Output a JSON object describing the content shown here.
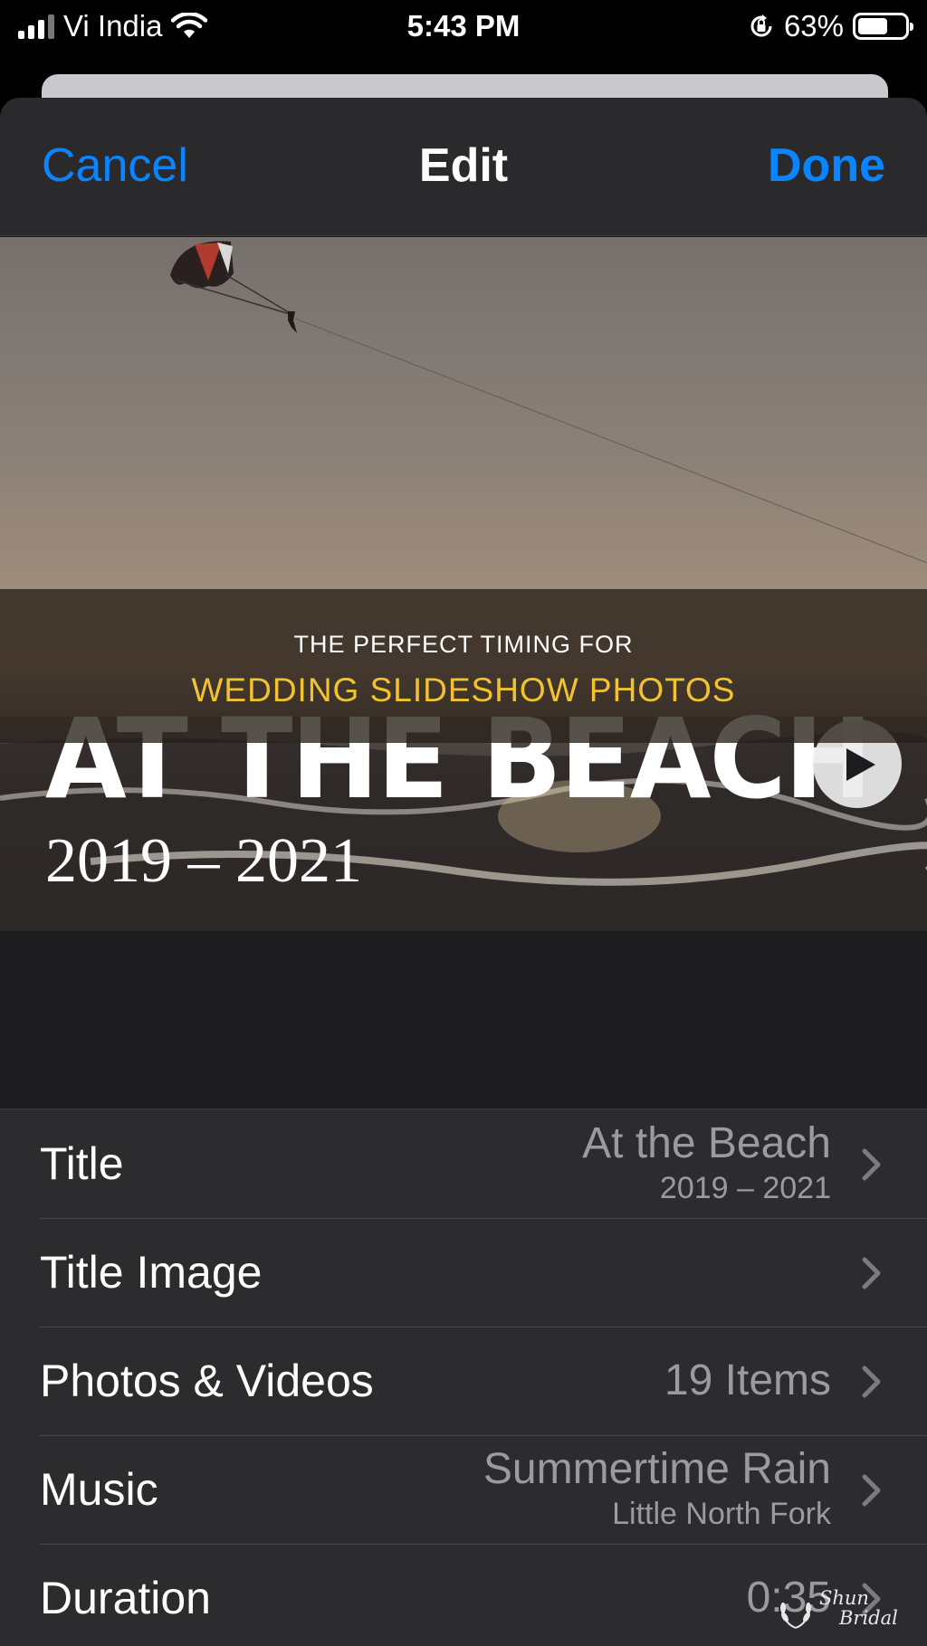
{
  "status_bar": {
    "carrier": "Vi India",
    "time": "5:43 PM",
    "battery": "63%",
    "battery_level": 0.63
  },
  "nav": {
    "cancel_label": "Cancel",
    "title": "Edit",
    "done_label": "Done"
  },
  "title_image": {
    "title": "AT THE BEACH",
    "years": "2019 – 2021"
  },
  "banner": {
    "line1": "THE PERFECT TIMING FOR",
    "line2": "WEDDING SLIDESHOW PHOTOS"
  },
  "rows": [
    {
      "label": "Title",
      "value": "At the Beach",
      "sub": "2019 – 2021"
    },
    {
      "label": "Title Image",
      "value": "",
      "sub": ""
    },
    {
      "label": "Photos & Videos",
      "value": "19 Items",
      "sub": ""
    },
    {
      "label": "Music",
      "value": "Summertime Rain",
      "sub": "Little North Fork"
    },
    {
      "label": "Duration",
      "value": "0:35",
      "sub": ""
    }
  ],
  "watermark": {
    "line1": "Shun",
    "line2": "Bridal"
  },
  "colors": {
    "accent": "#0a84ff",
    "banner_highlight": "#f2c230"
  }
}
